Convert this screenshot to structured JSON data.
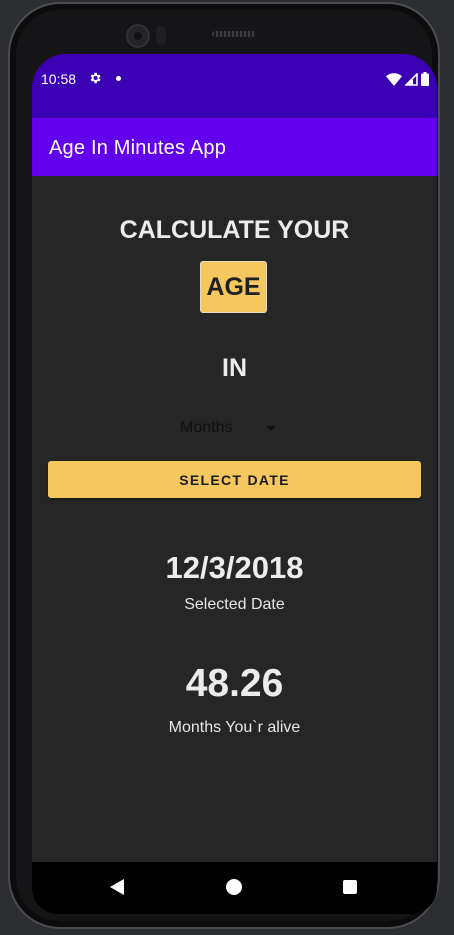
{
  "status_bar": {
    "time": "10:58"
  },
  "app_bar": {
    "title": "Age In Minutes App"
  },
  "main": {
    "heading": "CALCULATE YOUR",
    "age_label": "AGE",
    "in_label": "IN",
    "unit_spinner": {
      "selected": "Months"
    },
    "select_date_button": "SELECT DATE",
    "selected_date_value": "12/3/2018",
    "selected_date_caption": "Selected Date",
    "result_value": "48.26",
    "result_caption": "Months You`r alive"
  },
  "colors": {
    "status_bar": "#3c00b4",
    "app_bar": "#6200ee",
    "accent": "#f5c75f",
    "background": "#262626"
  }
}
